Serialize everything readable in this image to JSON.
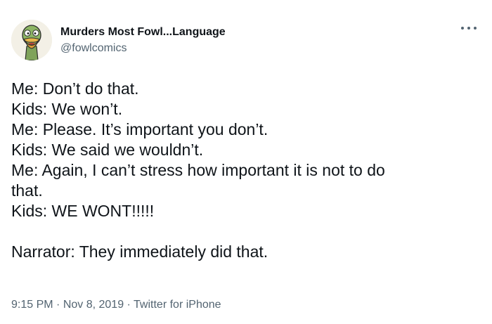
{
  "author": {
    "display_name": "Murders Most Fowl...Language",
    "handle": "@fowlcomics",
    "avatar_icon": "duck-cartoon-avatar"
  },
  "more_menu_icon": "more-horizontal-icon",
  "tweet": {
    "lines": [
      "Me: Don’t do that.",
      "Kids: We won’t.",
      "Me: Please. It’s important you don’t.",
      "Kids: We said we wouldn’t.",
      "Me: Again, I can’t stress how important it is not to do",
      "that.",
      "Kids: WE WONT!!!!!",
      "",
      "Narrator: They immediately did that."
    ]
  },
  "meta": {
    "time": "9:15 PM",
    "separator": " · ",
    "date": "Nov 8, 2019",
    "source": "Twitter for iPhone"
  },
  "colors": {
    "text_primary": "#0f1419",
    "text_secondary": "#536471",
    "background": "#ffffff"
  }
}
